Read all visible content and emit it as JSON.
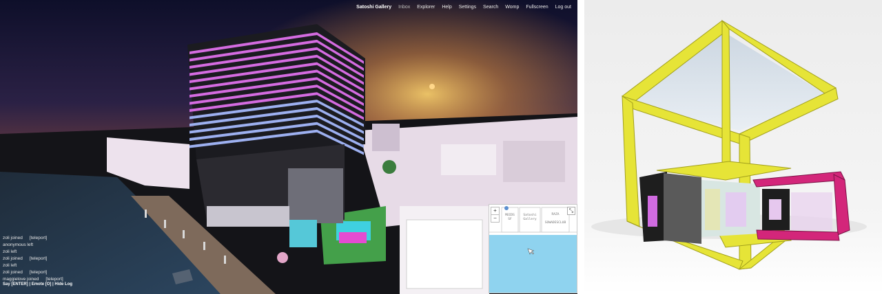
{
  "menu": {
    "items": [
      {
        "label": "Satoshi Gallery",
        "bold": true
      },
      {
        "label": "Inbox",
        "dim": true
      },
      {
        "label": "Explorer"
      },
      {
        "label": "Help"
      },
      {
        "label": "Settings"
      },
      {
        "label": "Search"
      },
      {
        "label": "Womp"
      },
      {
        "label": "Fullscreen"
      },
      {
        "label": "Log out"
      }
    ]
  },
  "chat": {
    "lines": [
      {
        "text": "zoli joined",
        "tag": "[teleport]"
      },
      {
        "text": "anonymous left",
        "tag": ""
      },
      {
        "text": "zoli left",
        "tag": ""
      },
      {
        "text": "zoli joined",
        "tag": "[teleport]"
      },
      {
        "text": "zoli left",
        "tag": ""
      },
      {
        "text": "zoli joined",
        "tag": "[teleport]"
      },
      {
        "text": "maggielove joined",
        "tag": "[teleport]"
      }
    ],
    "say": "Say [ENTER]",
    "emote": "Emote [O]",
    "hide": "Hide Log",
    "sep": " | "
  },
  "minimap": {
    "zoom_in": "+",
    "zoom_out": "−",
    "expand": "⤡",
    "labels": [
      {
        "text": "MOIDS\nSF"
      },
      {
        "text": "Satoshi\nGallery"
      },
      {
        "text": "RAZA"
      },
      {
        "text": "SOWADESCLUB"
      }
    ]
  },
  "colors": {
    "tower_stripe": "#d46be0",
    "tower_stripe_low": "#9db0f0",
    "frame_yellow": "#e6e437",
    "frame_pink": "#d3267a",
    "water_map": "#8fd3ef"
  }
}
